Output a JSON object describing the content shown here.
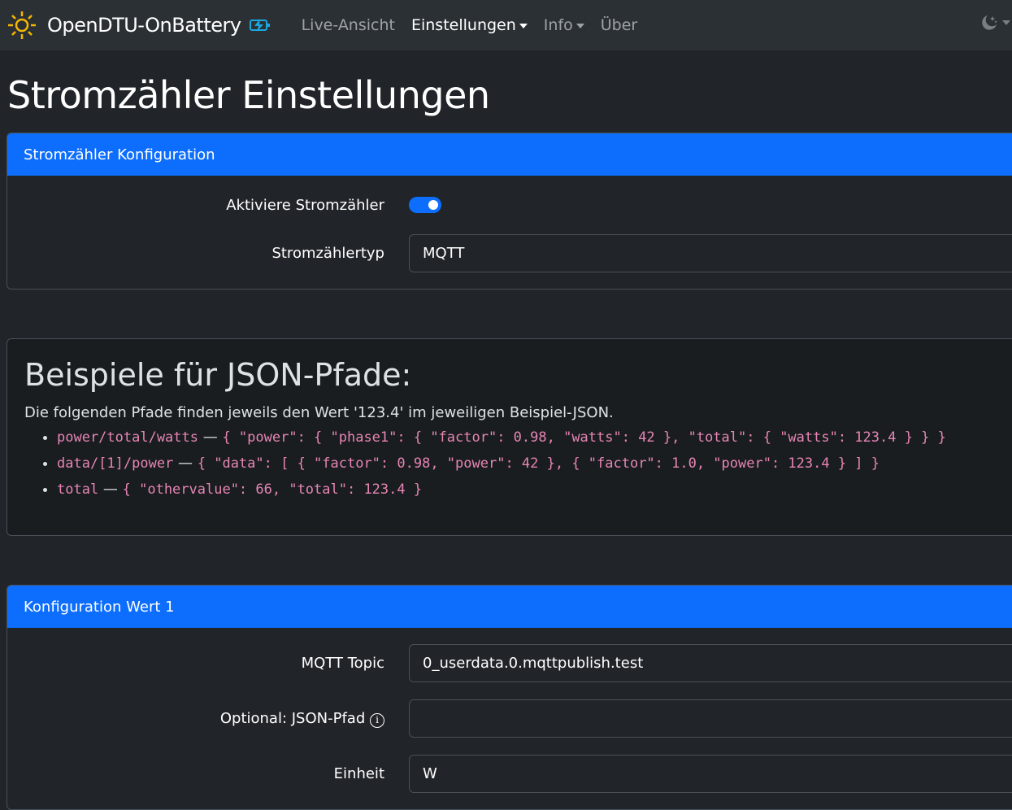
{
  "nav": {
    "brand": "OpenDTU-OnBattery",
    "links": [
      {
        "label": "Live-Ansicht"
      },
      {
        "label": "Einstellungen"
      },
      {
        "label": "Info"
      },
      {
        "label": "Über"
      }
    ]
  },
  "page": {
    "title": "Stromzähler Einstellungen"
  },
  "config": {
    "header": "Stromzähler Konfiguration",
    "enable_label": "Aktiviere Stromzähler",
    "enabled": true,
    "type_label": "Stromzählertyp",
    "type_value": "MQTT"
  },
  "examples": {
    "title": "Beispiele für JSON-Pfade:",
    "intro": "Die folgenden Pfade finden jeweils den Wert '123.4' im jeweiligen Beispiel-JSON.",
    "items": [
      {
        "path": "power/total/watts",
        "sep": " — ",
        "json": "{ \"power\": { \"phase1\": { \"factor\": 0.98, \"watts\": 42 }, \"total\": { \"watts\": 123.4 } } }"
      },
      {
        "path": "data/[1]/power",
        "sep": " — ",
        "json": "{ \"data\": [ { \"factor\": 0.98, \"power\": 42 }, { \"factor\": 1.0, \"power\": 123.4 } ] }"
      },
      {
        "path": "total",
        "sep": " — ",
        "json": "{ \"othervalue\": 66, \"total\": 123.4 }"
      }
    ]
  },
  "value1": {
    "header": "Konfiguration Wert 1",
    "topic_label": "MQTT Topic",
    "topic_value": "0_userdata.0.mqttpublish.test",
    "jsonpath_label": "Optional: JSON-Pfad",
    "jsonpath_value": "",
    "unit_label": "Einheit",
    "unit_value": "W"
  }
}
